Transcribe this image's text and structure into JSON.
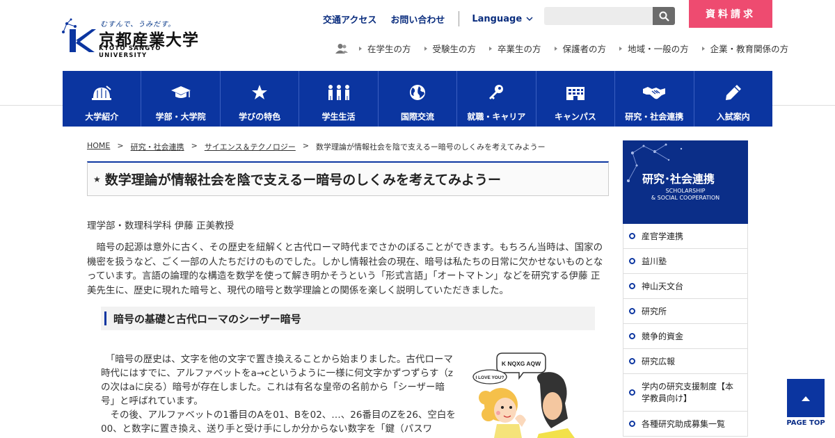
{
  "header": {
    "logo_tagline": "むすんで、うみだす。",
    "logo_name": "京都産業大学",
    "logo_sub": "KYOTO SANGYO UNIVERSITY",
    "access": "交通アクセス",
    "contact": "お問い合わせ",
    "language": "Language",
    "search_placeholder": "",
    "request": "資料請求"
  },
  "audience": [
    "在学生の方",
    "受験生の方",
    "卒業生の方",
    "保護者の方",
    "地域・一般の方",
    "企業・教育関係の方"
  ],
  "nav": [
    {
      "label": "大学紹介",
      "icon": "dome-icon"
    },
    {
      "label": "学部・大学院",
      "icon": "graduation-cap-icon"
    },
    {
      "label": "学びの特色",
      "icon": "star-icon"
    },
    {
      "label": "学生生活",
      "icon": "people-icon"
    },
    {
      "label": "国際交流",
      "icon": "globe-icon"
    },
    {
      "label": "就職・キャリア",
      "icon": "key-icon"
    },
    {
      "label": "キャンパス",
      "icon": "building-icon"
    },
    {
      "label": "研究・社会連携",
      "icon": "handshake-icon"
    },
    {
      "label": "入試案内",
      "icon": "pencil-icon"
    }
  ],
  "breadcrumb": [
    "HOME",
    "研究・社会連携",
    "サイエンス＆テクノロジー",
    "数学理論が情報社会を陰で支えるー暗号のしくみを考えてみようー"
  ],
  "article": {
    "title": "数学理論が情報社会を陰で支えるー暗号のしくみを考えてみようー",
    "author": "理学部・数理科学科 伊藤 正美教授",
    "intro": "暗号の起源は意外に古く、その歴史を紐解くと古代ローマ時代までさかのぼることができます。もちろん当時は、国家の機密を扱うなど、ごく一部の人たちだけのものでした。しかし情報社会の現在、暗号は私たちの日常に欠かせないものとなっています。言語の論理的な構造を数学を使って解き明かそうという「形式言語」「オートマトン」などを研究する伊藤 正美先生に、歴史に現れた暗号と、現代の暗号と数学理論との関係を楽しく説明していただきました。",
    "h2": "暗号の基礎と古代ローマのシーザー暗号",
    "body1": "「暗号の歴史は、文字を他の文字で置き換えることから始まりました。古代ローマ時代にはすでに、アルファベットをa→cというように一様に何文字かずつずらす（zの次はaに戻る）暗号が存在しました。これは有名な皇帝の名前から「シーザー暗号」と呼ばれています。",
    "body2": "その後、アルファベットの1番目のAを01、Bを02、…、26番目のZを26、空白を00、と数字に置き換え、送り手と受け手にしか分からない数字を「鍵（パスワ",
    "bubble1": "K NQXG AQW",
    "bubble2": "I LOVE YOU?"
  },
  "sidebar": {
    "title": "研究･社会連携",
    "subtitle1": "SCHOLARSHIP",
    "subtitle2": "& SOCIAL COOPERATION",
    "items": [
      "産官学連携",
      "益川塾",
      "神山天文台",
      "研究所",
      "競争的資金",
      "研究広報",
      "学内の研究支援制度【本学教員向け】",
      "各種研究助成募集一覧"
    ]
  },
  "pagetop": "PAGE TOP",
  "colors": {
    "brand": "#0b35a0",
    "request": "#ee4b70"
  }
}
